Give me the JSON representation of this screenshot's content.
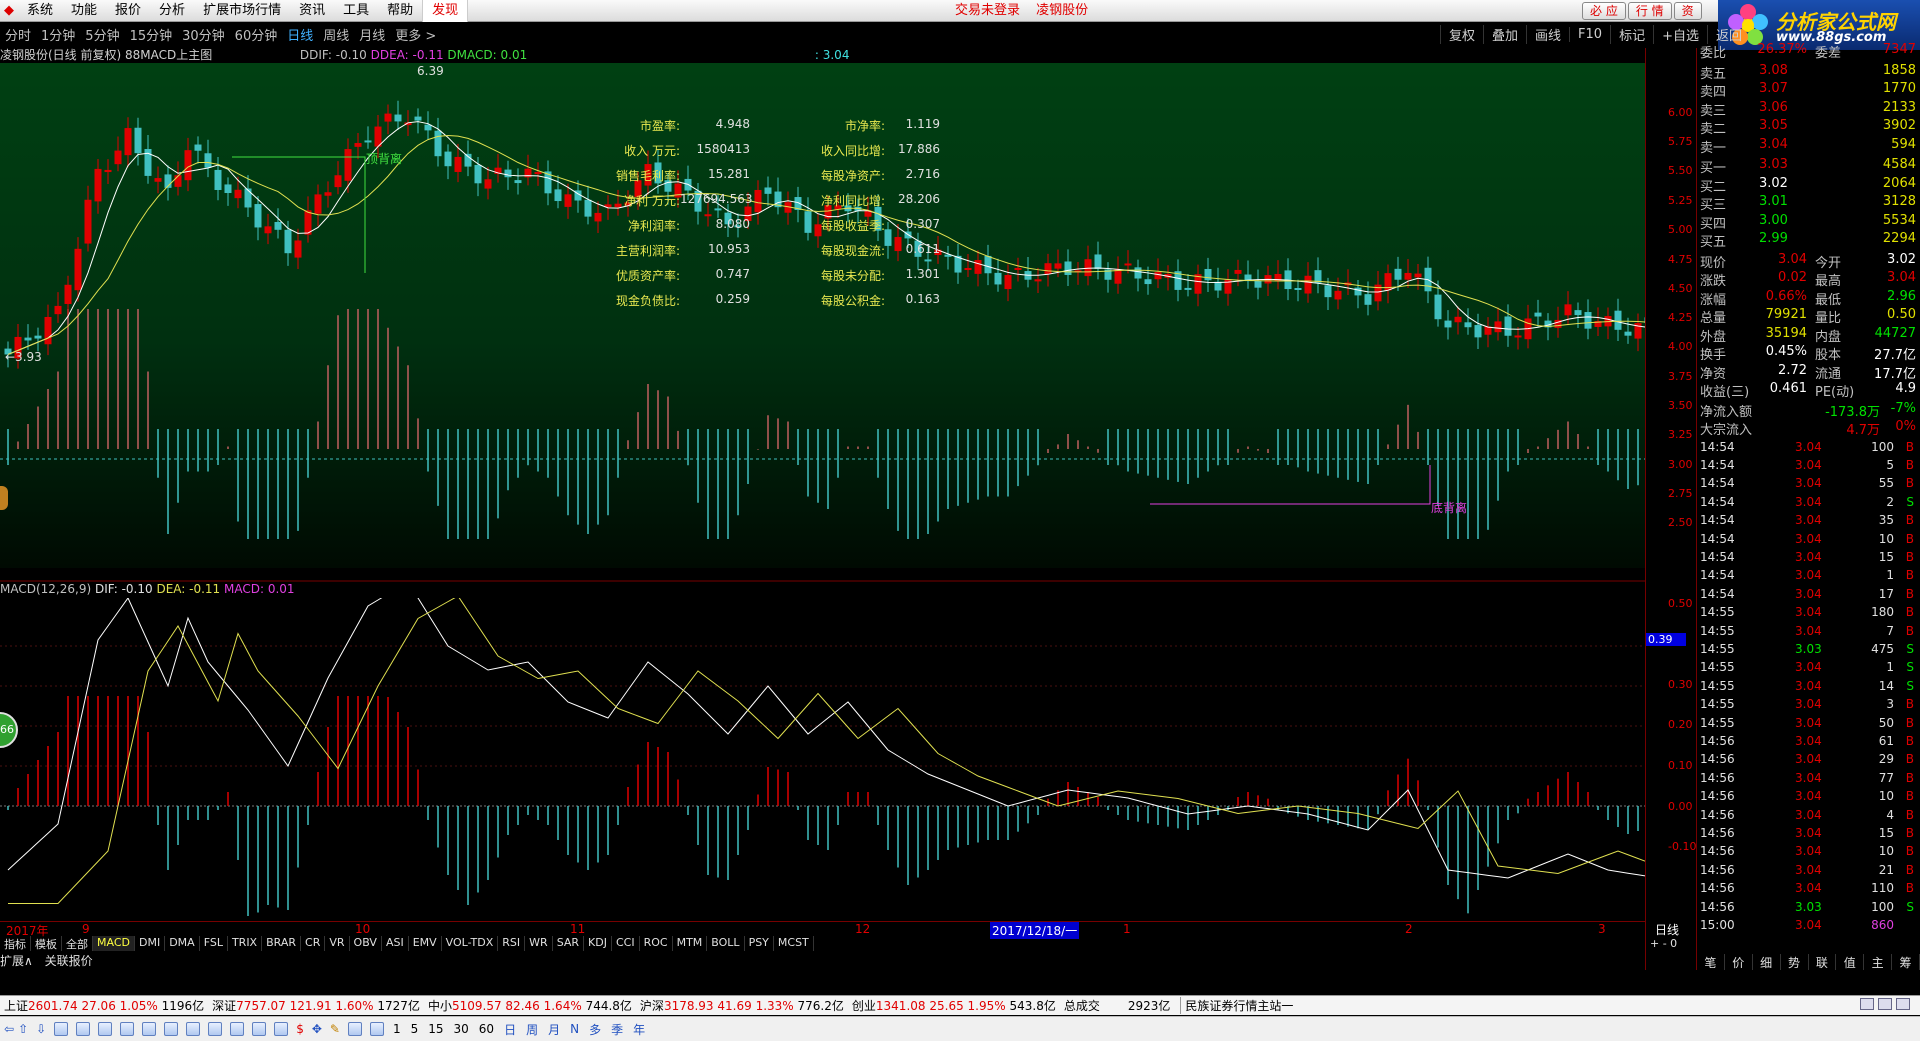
{
  "menu": {
    "items": [
      "系统",
      "功能",
      "报价",
      "分析",
      "扩展市场行情",
      "资讯",
      "工具",
      "帮助"
    ],
    "highlight": "发现",
    "notice1": "交易未登录",
    "notice2": "凌钢股份",
    "win_buttons": [
      "必 应",
      "行 情",
      "资"
    ]
  },
  "logo": {
    "title": "分析家公式网",
    "url": "www.88gs.com"
  },
  "periods": {
    "items": [
      "分时",
      "1分钟",
      "5分钟",
      "15分钟",
      "30分钟",
      "60分钟",
      "日线",
      "周线",
      "月线",
      "更多 >"
    ],
    "active": "日线",
    "tools": [
      "复权",
      "叠加",
      "画线",
      "F10",
      "标记",
      "+自选",
      "返回"
    ]
  },
  "title_line": {
    "stock": "凌钢股份(日线 前复权) 88MACD上主图",
    "ddif": "DDIF: -0.10",
    "ddea": "DDEA: -0.11",
    "dmacd": "DMACD: 0.01",
    "extra": ": 3.04"
  },
  "chart_annotations": {
    "high": "6.39",
    "low": "←3.93",
    "top_div": "顶背离",
    "bottom_div": "底背离"
  },
  "price_axis": [
    "6.00",
    "5.75",
    "5.50",
    "5.25",
    "5.00",
    "4.75",
    "4.50",
    "4.25",
    "4.00",
    "3.75",
    "3.50",
    "3.25",
    "3.00",
    "2.75",
    "2.50"
  ],
  "fundamentals": [
    {
      "l1": "市盈率:",
      "v1": "4.948",
      "l2": "市净率:",
      "v2": "1.119"
    },
    {
      "l1": "收入 万元:",
      "v1": "1580413",
      "l2": "收入同比增:",
      "v2": "17.886"
    },
    {
      "l1": "销售毛利率:",
      "v1": "15.281",
      "l2": "每股净资产:",
      "v2": "2.716"
    },
    {
      "l1": "净利 万元:",
      "v1": "127694.563",
      "l2": "净利同比增:",
      "v2": "28.206"
    },
    {
      "l1": "净利润率:",
      "v1": "8.080",
      "l2": "每股收益季:",
      "v2": "0.307"
    },
    {
      "l1": "主营利润率:",
      "v1": "10.953",
      "l2": "每股现金流:",
      "v2": "0.611"
    },
    {
      "l1": "优质资产率:",
      "v1": "0.747",
      "l2": "每股未分配:",
      "v2": "1.301"
    },
    {
      "l1": "现金负债比:",
      "v1": "0.259",
      "l2": "每股公积金:",
      "v2": "0.163"
    }
  ],
  "macd": {
    "name": "MACD(12,26,9)",
    "dif": "DIF: -0.10",
    "dea": "DEA: -0.11",
    "macd": "MACD: 0.01",
    "axis": [
      "0.50",
      "0.40",
      "0.30",
      "0.20",
      "0.10",
      "0.00",
      "-0.10"
    ],
    "marker": "0.39"
  },
  "dates": {
    "labels": [
      "2017年",
      "9",
      "10",
      "11",
      "12",
      "1",
      "2",
      "3"
    ],
    "cursor": "2017/12/18/一",
    "period": "日线",
    "zoom": "+ - 0"
  },
  "indicator_tabs": [
    "指标",
    "模板",
    "全部",
    "MACD",
    "DMI",
    "DMA",
    "FSL",
    "TRIX",
    "BRAR",
    "CR",
    "VR",
    "OBV",
    "ASI",
    "EMV",
    "VOL-TDX",
    "RSI",
    "WR",
    "SAR",
    "KDJ",
    "CCI",
    "ROC",
    "MTM",
    "BOLL",
    "PSY",
    "MCST"
  ],
  "ext_tabs": [
    "扩展∧",
    "关联报价"
  ],
  "circle_badge": "66",
  "quote": {
    "weibi": {
      "a": "委比",
      "b": "26.37%",
      "c": "委差",
      "d": "7347"
    },
    "asks": [
      {
        "label": "卖五",
        "price": "3.08",
        "vol": "1858"
      },
      {
        "label": "卖四",
        "price": "3.07",
        "vol": "1770"
      },
      {
        "label": "卖三",
        "price": "3.06",
        "vol": "2133"
      },
      {
        "label": "卖二",
        "price": "3.05",
        "vol": "3902"
      },
      {
        "label": "卖一",
        "price": "3.04",
        "vol": "594"
      }
    ],
    "bids": [
      {
        "label": "买一",
        "price": "3.03",
        "vol": "4584"
      },
      {
        "label": "买二",
        "price": "3.02",
        "vol": "2064"
      },
      {
        "label": "买三",
        "price": "3.01",
        "vol": "3128"
      },
      {
        "label": "买四",
        "price": "3.00",
        "vol": "5534"
      },
      {
        "label": "买五",
        "price": "2.99",
        "vol": "2294"
      }
    ],
    "stats": [
      {
        "a": "现价",
        "b": "3.04",
        "c": "今开",
        "d": "3.02"
      },
      {
        "a": "涨跌",
        "b": "0.02",
        "c": "最高",
        "d": "3.04"
      },
      {
        "a": "涨幅",
        "b": "0.66%",
        "c": "最低",
        "d": "2.96"
      },
      {
        "a": "总量",
        "b": "79921",
        "c": "量比",
        "d": "0.50"
      },
      {
        "a": "外盘",
        "b": "35194",
        "c": "内盘",
        "d": "44727"
      },
      {
        "a": "换手",
        "b": "0.45%",
        "c": "股本",
        "d": "27.7亿"
      },
      {
        "a": "净资",
        "b": "2.72",
        "c": "流通",
        "d": "17.7亿"
      },
      {
        "a": "收益(三)",
        "b": "0.461",
        "c": "PE(动)",
        "d": "4.9"
      }
    ],
    "flow1": {
      "label": "净流入额",
      "value": "-173.8万",
      "pct": "-7%"
    },
    "flow2": {
      "label": "大宗流入",
      "value": "4.7万",
      "pct": "0%"
    }
  },
  "ticks": [
    {
      "t": "14:54",
      "p": "3.04",
      "v": "100",
      "s": "B"
    },
    {
      "t": "14:54",
      "p": "3.04",
      "v": "5",
      "s": "B"
    },
    {
      "t": "14:54",
      "p": "3.04",
      "v": "55",
      "s": "B"
    },
    {
      "t": "14:54",
      "p": "3.04",
      "v": "2",
      "s": "S"
    },
    {
      "t": "14:54",
      "p": "3.04",
      "v": "35",
      "s": "B"
    },
    {
      "t": "14:54",
      "p": "3.04",
      "v": "10",
      "s": "B"
    },
    {
      "t": "14:54",
      "p": "3.04",
      "v": "15",
      "s": "B"
    },
    {
      "t": "14:54",
      "p": "3.04",
      "v": "1",
      "s": "B"
    },
    {
      "t": "14:54",
      "p": "3.04",
      "v": "17",
      "s": "B"
    },
    {
      "t": "14:55",
      "p": "3.04",
      "v": "180",
      "s": "B"
    },
    {
      "t": "14:55",
      "p": "3.04",
      "v": "7",
      "s": "B"
    },
    {
      "t": "14:55",
      "p": "3.03",
      "v": "475",
      "s": "S"
    },
    {
      "t": "14:55",
      "p": "3.04",
      "v": "1",
      "s": "S"
    },
    {
      "t": "14:55",
      "p": "3.04",
      "v": "14",
      "s": "S"
    },
    {
      "t": "14:55",
      "p": "3.04",
      "v": "3",
      "s": "B"
    },
    {
      "t": "14:55",
      "p": "3.04",
      "v": "50",
      "s": "B"
    },
    {
      "t": "14:56",
      "p": "3.04",
      "v": "61",
      "s": "B"
    },
    {
      "t": "14:56",
      "p": "3.04",
      "v": "29",
      "s": "B"
    },
    {
      "t": "14:56",
      "p": "3.04",
      "v": "77",
      "s": "B"
    },
    {
      "t": "14:56",
      "p": "3.04",
      "v": "10",
      "s": "B"
    },
    {
      "t": "14:56",
      "p": "3.04",
      "v": "4",
      "s": "B"
    },
    {
      "t": "14:56",
      "p": "3.04",
      "v": "15",
      "s": "B"
    },
    {
      "t": "14:56",
      "p": "3.04",
      "v": "10",
      "s": "B"
    },
    {
      "t": "14:56",
      "p": "3.04",
      "v": "21",
      "s": "B"
    },
    {
      "t": "14:56",
      "p": "3.04",
      "v": "110",
      "s": "B"
    },
    {
      "t": "14:56",
      "p": "3.03",
      "v": "100",
      "s": "S"
    },
    {
      "t": "15:00",
      "p": "3.04",
      "v": "860",
      "s": ""
    }
  ],
  "right_tabs": [
    "笔",
    "价",
    "细",
    "势",
    "联",
    "值",
    "主",
    "筹"
  ],
  "status": {
    "sh": {
      "name": "上证",
      "idx": "2601.74",
      "chg": "27.06",
      "pct": "1.05%",
      "amt": "1196亿"
    },
    "sz": {
      "name": "深证",
      "idx": "7757.07",
      "chg": "121.91",
      "pct": "1.60%",
      "amt": "1727亿"
    },
    "zx": {
      "name": "中小",
      "idx": "5109.57",
      "chg": "82.46",
      "pct": "1.64%",
      "amt": "744.8亿"
    },
    "hs": {
      "name": "沪深",
      "idx": "3178.93",
      "chg": "41.69",
      "pct": "1.33%",
      "amt": "776.2亿"
    },
    "cy": {
      "name": "创业",
      "idx": "1341.08",
      "chg": "25.65",
      "pct": "1.95%",
      "amt": "543.8亿"
    },
    "total_label": "总成交",
    "total": "2923亿",
    "broker": "民族证券行情主站一"
  },
  "bottom": {
    "periods": [
      "1",
      "5",
      "15",
      "30",
      "60",
      "日",
      "周",
      "月",
      "N",
      "多",
      "季",
      "年"
    ]
  },
  "colors": {
    "up": "#e00000",
    "down": "#40c0c0",
    "dif": "#ffffff",
    "dea": "#e0e050"
  }
}
